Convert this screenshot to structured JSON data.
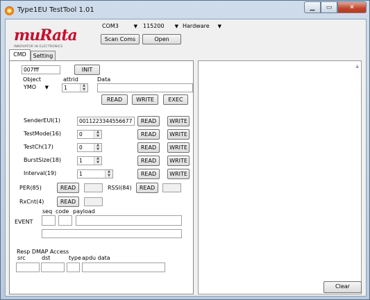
{
  "window": {
    "title": "Type1EU TestTool 1.01"
  },
  "logo": {
    "text": "muRata",
    "tagline": "INNOVATOR IN ELECTRONICS"
  },
  "toolbar": {
    "com_port": "COM3",
    "baud_rate": "115200",
    "flow": "Hardware",
    "scan_label": "Scan Coms",
    "open_label": "Open"
  },
  "tabs": [
    {
      "label": "CMD"
    },
    {
      "label": "Setting"
    }
  ],
  "cmd": {
    "address_value": "007fff",
    "init_label": "INIT",
    "object_label": "Object",
    "attrid_label": "attrid",
    "data_label": "Data",
    "object_value": "YMO",
    "attrid_value": "1",
    "data_value": "",
    "read_label": "READ",
    "write_label": "WRITE",
    "exec_label": "EXEC",
    "rows": [
      {
        "label": "SenderEUI(1)",
        "value": "0011223344556677"
      },
      {
        "label": "TestMode(16)",
        "value": "0"
      },
      {
        "label": "TestCh(17)",
        "value": "0"
      },
      {
        "label": "BurstSize(18)",
        "value": "1"
      },
      {
        "label": "Interval(19)",
        "value": "1"
      }
    ],
    "per_label": "PER(85)",
    "rssi_label": "RSSI(84)",
    "rxcnt_label": "RxCnt(4)",
    "event_label": "EVENT",
    "seq_label": "seq",
    "code_label": "code",
    "payload_label": "payload",
    "resp_label": "Resp DMAP Access",
    "src_label": "src",
    "dst_label": "dst",
    "type_label": "type",
    "apdu_label": "apdu data"
  },
  "log": {
    "clear_label": "Clear"
  },
  "colors": {
    "brand": "#c8102e",
    "close": "#c4452c"
  }
}
